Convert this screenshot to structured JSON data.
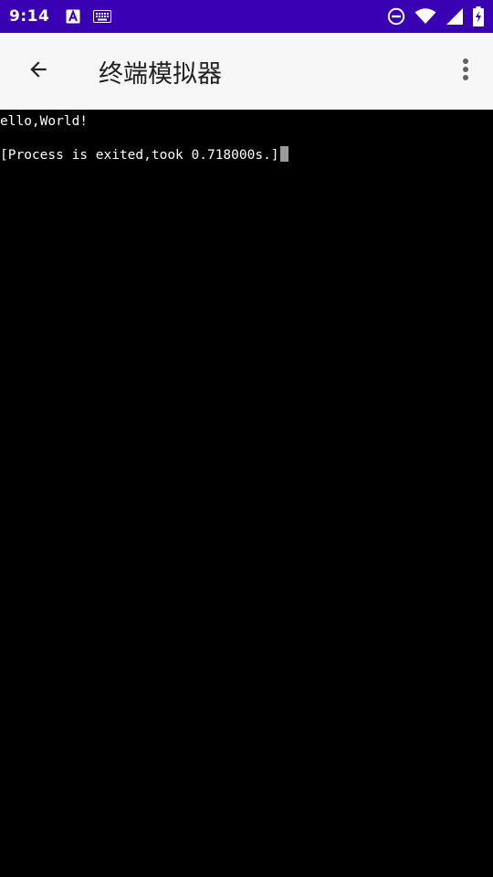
{
  "status_bar": {
    "time": "9:14",
    "left_icons": [
      "font-a-icon",
      "keyboard-icon"
    ],
    "right_icons": [
      "do-not-disturb-icon",
      "wifi-icon",
      "signal-icon",
      "battery-charging-icon"
    ],
    "background_color": "#3a00b4"
  },
  "app_bar": {
    "title": "终端模拟器",
    "back_icon": "arrow-back-icon",
    "overflow_icon": "more-vert-icon"
  },
  "terminal": {
    "lines": [
      "ello,World!",
      "[Process is exited,took 0.718000s.]"
    ],
    "cursor_color": "#9a9a9a"
  }
}
